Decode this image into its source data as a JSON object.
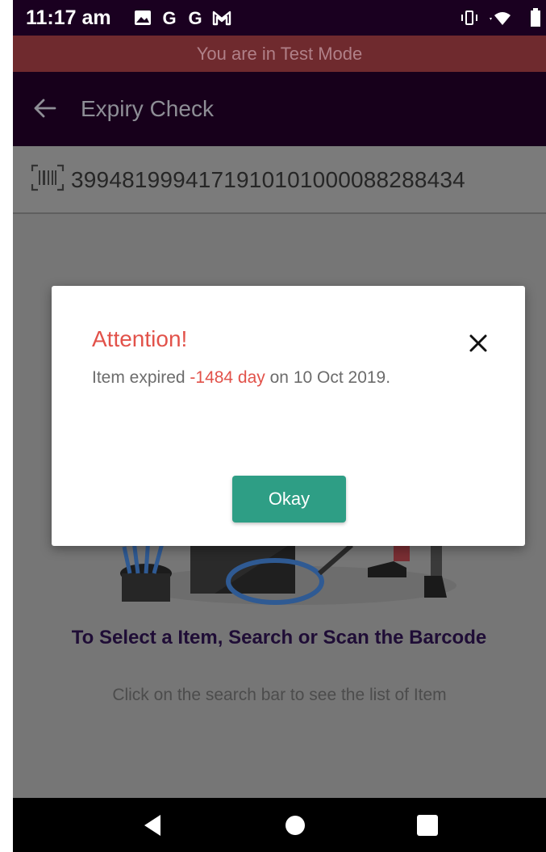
{
  "status_bar": {
    "time": "11:17 am",
    "icons": [
      "image-icon",
      "google-icon",
      "google-icon",
      "gmail-icon",
      "vibrate-icon",
      "wifi-icon",
      "battery-icon"
    ]
  },
  "banner": {
    "text": "You are in Test Mode"
  },
  "app_bar": {
    "title": "Expiry Check",
    "back_icon": "arrow-left-icon"
  },
  "search": {
    "icon": "barcode-scan-icon",
    "value": "3994819994171910101000088288434"
  },
  "empty_state": {
    "title": "To Select a Item, Search or Scan the Barcode",
    "subtitle": "Click on the search bar to see the list of Item"
  },
  "dialog": {
    "title": "Attention!",
    "message_prefix": "Item expired ",
    "message_days": "-1484 day",
    "message_suffix": " on 10 Oct 2019.",
    "button_label": "Okay",
    "close_icon": "close-icon"
  },
  "nav": {
    "icons": [
      "back-triangle-icon",
      "home-circle-icon",
      "recents-square-icon"
    ]
  },
  "colors": {
    "accent_red": "#e2524a",
    "button_green": "#2e9e85",
    "app_bar": "#17001b",
    "banner": "#6f2a2e"
  }
}
